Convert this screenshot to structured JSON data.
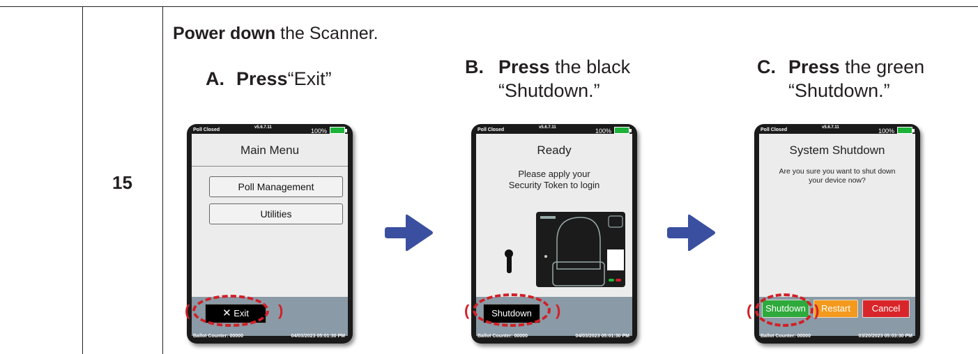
{
  "step_number": "15",
  "intro": {
    "bold": "Power down",
    "rest": " the Scanner."
  },
  "steps": {
    "a": {
      "letter": "A.",
      "bold": "Press",
      "rest": "“Exit”",
      "line2": ""
    },
    "b": {
      "letter": "B.",
      "bold": "Press",
      "rest": " the black",
      "line2": "“Shutdown.”"
    },
    "c": {
      "letter": "C.",
      "bold": "Press",
      "rest": " the green",
      "line2": "“Shutdown.”"
    }
  },
  "devices": {
    "a": {
      "status": "Poll Closed",
      "version": "v5.6.7.11",
      "battery": "100%",
      "title": "Main Menu",
      "menu": [
        "Poll Management",
        "Utilities"
      ],
      "exit_label": "Exit",
      "exit_icon": "x-icon",
      "ballot_counter": "Ballot Counter: 00000",
      "datetime": "04/03/2023 05:01:30 PM"
    },
    "b": {
      "status": "Poll Closed",
      "version": "v5.6.7.11",
      "battery": "100%",
      "title": "Ready",
      "message_l1": "Please apply your",
      "message_l2": "Security Token to login",
      "shutdown_label": "Shutdown",
      "ballot_counter": "Ballot Counter: 00000",
      "datetime": "04/03/2023 05:01:30 PM"
    },
    "c": {
      "status": "Poll Closed",
      "version": "v5.6.7.11",
      "battery": "100%",
      "title": "System Shutdown",
      "message_l1": "Are you sure you want to shut down",
      "message_l2": "your device now?",
      "buttons": [
        "Shutdown",
        "Restart",
        "Cancel"
      ],
      "ballot_counter": "Ballot Counter: 00000",
      "datetime": "03/20/2023 05:03:30 PM"
    }
  },
  "colors": {
    "highlight": "#d11f26",
    "arrow": "#3a4f9f",
    "shutdown_green": "#2eaa3c",
    "restart_orange": "#f39a1e",
    "cancel_red": "#d9252a",
    "footer_gray": "#8a9aa6"
  }
}
